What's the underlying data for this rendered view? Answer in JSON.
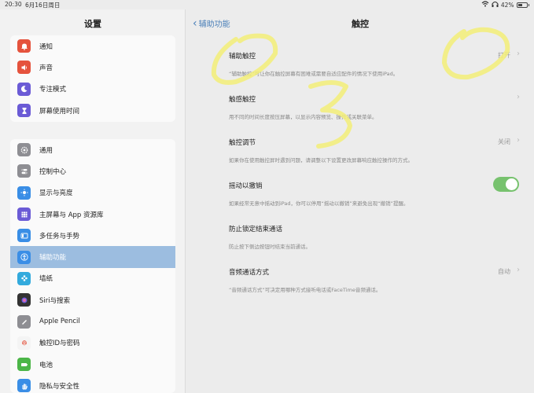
{
  "status": {
    "time": "20:30",
    "date": "6月16日周日",
    "battery": "42%"
  },
  "sidebar": {
    "title": "设置",
    "group1": [
      {
        "label": "通知",
        "icon": "bell-icon",
        "color": "#e5533d"
      },
      {
        "label": "声音",
        "icon": "speaker-icon",
        "color": "#e5533d"
      },
      {
        "label": "专注模式",
        "icon": "moon-icon",
        "color": "#6b5bd6"
      },
      {
        "label": "屏幕使用时间",
        "icon": "hourglass-icon",
        "color": "#6b5bd6"
      }
    ],
    "group2": [
      {
        "label": "通用",
        "icon": "gear-icon",
        "color": "#8e8e93"
      },
      {
        "label": "控制中心",
        "icon": "switches-icon",
        "color": "#8e8e93"
      },
      {
        "label": "显示与亮度",
        "icon": "sun-icon",
        "color": "#3a8ee6"
      },
      {
        "label": "主屏幕与 App 资源库",
        "icon": "grid-icon",
        "color": "#6b5bd6"
      },
      {
        "label": "多任务与手势",
        "icon": "multitask-icon",
        "color": "#3a8ee6"
      },
      {
        "label": "辅助功能",
        "icon": "accessibility-icon",
        "color": "#3a8ee6",
        "selected": true
      },
      {
        "label": "墙纸",
        "icon": "flower-icon",
        "color": "#33aadd"
      },
      {
        "label": "Siri与搜索",
        "icon": "siri-icon",
        "color": "#333333"
      },
      {
        "label": "Apple Pencil",
        "icon": "pencil-icon",
        "color": "#8e8e93"
      },
      {
        "label": "触控ID与密码",
        "icon": "fingerprint-icon",
        "color": "#e5533d"
      },
      {
        "label": "电池",
        "icon": "battery-icon",
        "color": "#4cb648"
      },
      {
        "label": "隐私与安全性",
        "icon": "hand-icon",
        "color": "#3a8ee6"
      }
    ]
  },
  "main": {
    "back_label": "辅助功能",
    "title": "触控",
    "rows": [
      {
        "label": "辅助触控",
        "value": "打开",
        "desc": "“辅助触控”可让你在触控屏幕有困难或需要自适应配件的情况下使用iPad。"
      },
      {
        "label": "触感触控",
        "value": "",
        "desc": "用不同的时间长度按压屏幕，以显示内容预览、操作或关联菜单。"
      },
      {
        "label": "触控调节",
        "value": "关闭",
        "desc": "如果你在使用触控屏时遇到问题，请调整以下设置更改屏幕响应触控操作的方式。"
      },
      {
        "label": "摇动以撤销",
        "value": "",
        "toggle": true,
        "desc": "如果经常无意中摇动到iPad，你可以停用“摇动以撤销”来避免出现“撤销”提醒。"
      },
      {
        "label": "防止锁定结束通话",
        "value": "",
        "desc": "防止按下侧边按钮时结束当前通话。"
      },
      {
        "label": "音频通话方式",
        "value": "自动",
        "desc": "“音频通话方式”可决定用哪种方式接听电话或FaceTime音频通话。"
      }
    ],
    "toggle_on": true
  },
  "colors": {
    "accent": "#4a7fb8",
    "selected": "#9cbde0",
    "toggle": "#77c26e",
    "handwriting": "#f3ee78"
  }
}
